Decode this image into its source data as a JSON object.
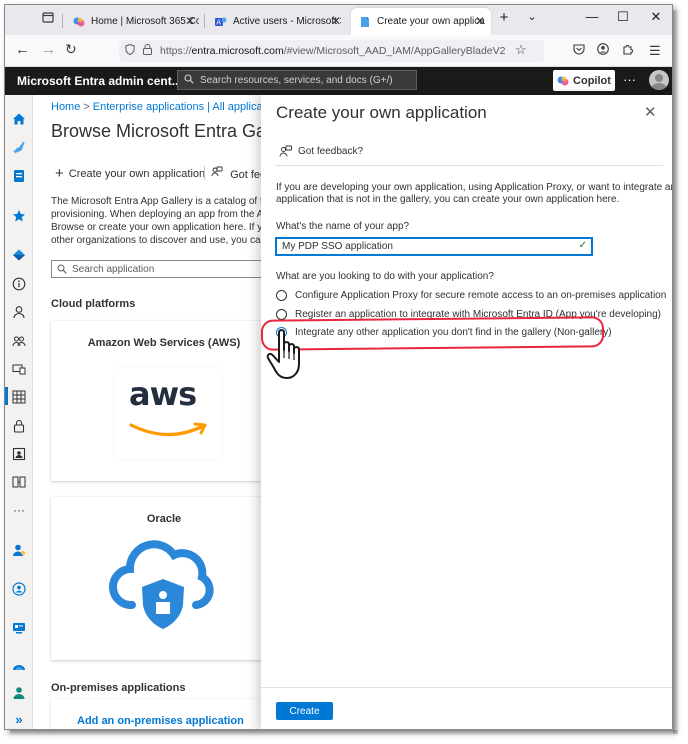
{
  "browser": {
    "tabs": [
      {
        "label": "Home | Microsoft 365 Copi",
        "icon": "copilot-icon"
      },
      {
        "label": "Active users - Microsoft 36",
        "icon": "admin-center-icon"
      },
      {
        "label": "Create your own applicatio",
        "icon": "entra-icon"
      }
    ],
    "url_prefix": "https://",
    "url_host": "entra.microsoft.com",
    "url_path": "/#view/Microsoft_AAD_IAM/AppGalleryBladeV2"
  },
  "header": {
    "app_title": "Microsoft Entra admin cent...",
    "search_placeholder": "Search resources, services, and docs (G+/)",
    "copilot_label": "Copilot"
  },
  "background": {
    "breadcrumb": [
      "Home",
      "Enterprise applications | All applicatio"
    ],
    "title": "Browse Microsoft Entra Gal",
    "create_own": "Create your own application",
    "feedback": "Got fee",
    "description": [
      "The Microsoft Entra App Gallery is a catalog of thou",
      "provisioning. When deploying an app from the App",
      "Browse or create your own application here. If you",
      "other organizations to discover and use, you can fil"
    ],
    "search_placeholder": "Search application",
    "cloud_heading": "Cloud platforms",
    "cards": [
      {
        "title": "Amazon Web Services (AWS)",
        "logo_text": "aws"
      },
      {
        "title": "Oracle"
      }
    ],
    "onprem_heading": "On-premises applications",
    "onprem_link": "Add an on-premises application"
  },
  "panel": {
    "title": "Create your own application",
    "feedback": "Got feedback?",
    "intro": [
      "If you are developing your own application, using Application Proxy, or want to integrate an",
      "application that is not in the gallery, you can create your own application here."
    ],
    "name_label": "What's the name of your app?",
    "name_value": "My PDP SSO application",
    "purpose_label": "What are you looking to do with your application?",
    "options": [
      {
        "label": "Configure Application Proxy for secure remote access to an on-premises application",
        "checked": false
      },
      {
        "label": "Register an application to integrate with Microsoft Entra ID (App you're developing)",
        "checked": false
      },
      {
        "label": "Integrate any other application you don't find in the gallery (Non-gallery)",
        "checked": true
      }
    ],
    "create_label": "Create"
  },
  "colors": {
    "accent": "#0078d4",
    "header_bg": "#1b1a19",
    "highlight": "#e8273c",
    "aws_orange": "#ff9900",
    "oracle_blue": "#2b88d8"
  }
}
